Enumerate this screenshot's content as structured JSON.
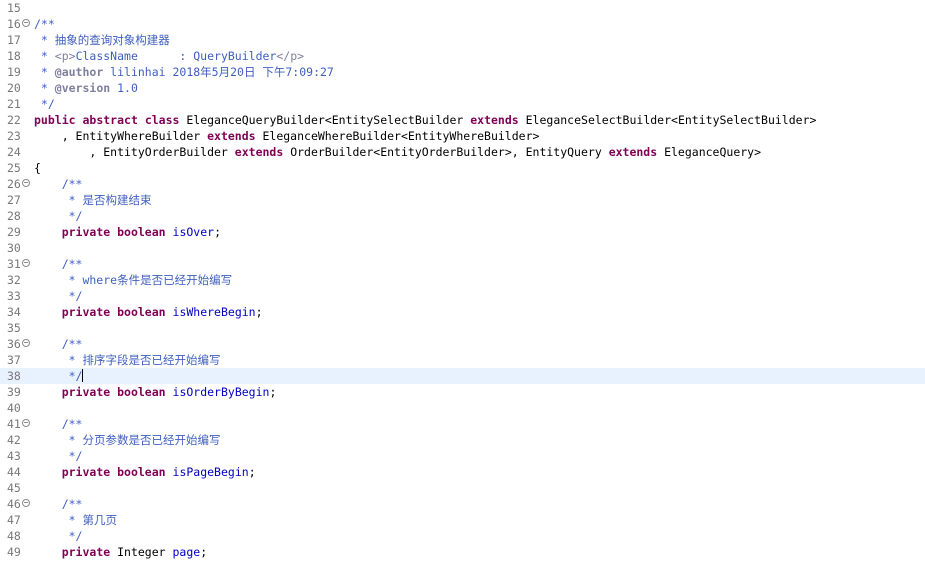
{
  "editor": {
    "colors": {
      "comment": "#3f5fbf",
      "javadoc_tag": "#7f7f9f",
      "keyword": "#7f0055",
      "field": "#0000c0",
      "line_number": "#787878",
      "current_line": "#e8f2fe"
    },
    "lines": [
      {
        "n": "15",
        "fold": false,
        "tokens": []
      },
      {
        "n": "16",
        "fold": true,
        "tokens": [
          {
            "t": "/**",
            "c": "comment"
          }
        ]
      },
      {
        "n": "17",
        "fold": false,
        "tokens": [
          {
            "t": " * 抽象的查询对象构建器",
            "c": "comment"
          }
        ]
      },
      {
        "n": "18",
        "fold": false,
        "tokens": [
          {
            "t": " * ",
            "c": "comment"
          },
          {
            "t": "<p>",
            "c": "tag"
          },
          {
            "t": "ClassName      : QueryBuilder",
            "c": "comment"
          },
          {
            "t": "</p>",
            "c": "tag"
          }
        ]
      },
      {
        "n": "19",
        "fold": false,
        "tokens": [
          {
            "t": " * ",
            "c": "comment"
          },
          {
            "t": "@author",
            "c": "tagbold"
          },
          {
            "t": " lilinhai 2018年5月20日 下午7:09:27",
            "c": "comment"
          }
        ]
      },
      {
        "n": "20",
        "fold": false,
        "tokens": [
          {
            "t": " * ",
            "c": "comment"
          },
          {
            "t": "@version",
            "c": "tagbold"
          },
          {
            "t": " 1.0",
            "c": "comment"
          }
        ]
      },
      {
        "n": "21",
        "fold": false,
        "tokens": [
          {
            "t": " */",
            "c": "comment"
          }
        ]
      },
      {
        "n": "22",
        "fold": false,
        "tokens": [
          {
            "t": "public",
            "c": "keyword"
          },
          {
            "t": " ",
            "c": "plain"
          },
          {
            "t": "abstract",
            "c": "keyword"
          },
          {
            "t": " ",
            "c": "plain"
          },
          {
            "t": "class",
            "c": "keyword"
          },
          {
            "t": " EleganceQueryBuilder<EntitySelectBuilder ",
            "c": "plain"
          },
          {
            "t": "extends",
            "c": "keyword"
          },
          {
            "t": " EleganceSelectBuilder<EntitySelectBuilder>",
            "c": "plain"
          }
        ]
      },
      {
        "n": "23",
        "fold": false,
        "tokens": [
          {
            "t": "    , EntityWhereBuilder ",
            "c": "plain"
          },
          {
            "t": "extends",
            "c": "keyword"
          },
          {
            "t": " EleganceWhereBuilder<EntityWhereBuilder>",
            "c": "plain"
          }
        ]
      },
      {
        "n": "24",
        "fold": false,
        "tokens": [
          {
            "t": "        , EntityOrderBuilder ",
            "c": "plain"
          },
          {
            "t": "extends",
            "c": "keyword"
          },
          {
            "t": " OrderBuilder<EntityOrderBuilder>, EntityQuery ",
            "c": "plain"
          },
          {
            "t": "extends",
            "c": "keyword"
          },
          {
            "t": " EleganceQuery>",
            "c": "plain"
          }
        ]
      },
      {
        "n": "25",
        "fold": false,
        "tokens": [
          {
            "t": "{",
            "c": "plain"
          }
        ]
      },
      {
        "n": "26",
        "fold": true,
        "tokens": [
          {
            "t": "    ",
            "c": "plain"
          },
          {
            "t": "/**",
            "c": "comment"
          }
        ]
      },
      {
        "n": "27",
        "fold": false,
        "tokens": [
          {
            "t": "     * 是否构建结束",
            "c": "comment"
          }
        ]
      },
      {
        "n": "28",
        "fold": false,
        "tokens": [
          {
            "t": "     */",
            "c": "comment"
          }
        ]
      },
      {
        "n": "29",
        "fold": false,
        "tokens": [
          {
            "t": "    ",
            "c": "plain"
          },
          {
            "t": "private",
            "c": "keyword"
          },
          {
            "t": " ",
            "c": "plain"
          },
          {
            "t": "boolean",
            "c": "keyword"
          },
          {
            "t": " ",
            "c": "plain"
          },
          {
            "t": "isOver",
            "c": "field"
          },
          {
            "t": ";",
            "c": "plain"
          }
        ]
      },
      {
        "n": "30",
        "fold": false,
        "tokens": []
      },
      {
        "n": "31",
        "fold": true,
        "tokens": [
          {
            "t": "    ",
            "c": "plain"
          },
          {
            "t": "/**",
            "c": "comment"
          }
        ]
      },
      {
        "n": "32",
        "fold": false,
        "tokens": [
          {
            "t": "     * where条件是否已经开始编写",
            "c": "comment"
          }
        ]
      },
      {
        "n": "33",
        "fold": false,
        "tokens": [
          {
            "t": "     */",
            "c": "comment"
          }
        ]
      },
      {
        "n": "34",
        "fold": false,
        "tokens": [
          {
            "t": "    ",
            "c": "plain"
          },
          {
            "t": "private",
            "c": "keyword"
          },
          {
            "t": " ",
            "c": "plain"
          },
          {
            "t": "boolean",
            "c": "keyword"
          },
          {
            "t": " ",
            "c": "plain"
          },
          {
            "t": "isWhereBegin",
            "c": "field"
          },
          {
            "t": ";",
            "c": "plain"
          }
        ]
      },
      {
        "n": "35",
        "fold": false,
        "tokens": []
      },
      {
        "n": "36",
        "fold": true,
        "tokens": [
          {
            "t": "    ",
            "c": "plain"
          },
          {
            "t": "/**",
            "c": "comment"
          }
        ]
      },
      {
        "n": "37",
        "fold": false,
        "tokens": [
          {
            "t": "     * 排序字段是否已经开始编写",
            "c": "comment"
          }
        ]
      },
      {
        "n": "38",
        "fold": false,
        "current": true,
        "tokens": [
          {
            "t": "     */",
            "c": "comment"
          }
        ]
      },
      {
        "n": "39",
        "fold": false,
        "tokens": [
          {
            "t": "    ",
            "c": "plain"
          },
          {
            "t": "private",
            "c": "keyword"
          },
          {
            "t": " ",
            "c": "plain"
          },
          {
            "t": "boolean",
            "c": "keyword"
          },
          {
            "t": " ",
            "c": "plain"
          },
          {
            "t": "isOrderByBegin",
            "c": "field"
          },
          {
            "t": ";",
            "c": "plain"
          }
        ]
      },
      {
        "n": "40",
        "fold": false,
        "tokens": []
      },
      {
        "n": "41",
        "fold": true,
        "tokens": [
          {
            "t": "    ",
            "c": "plain"
          },
          {
            "t": "/**",
            "c": "comment"
          }
        ]
      },
      {
        "n": "42",
        "fold": false,
        "tokens": [
          {
            "t": "     * 分页参数是否已经开始编写",
            "c": "comment"
          }
        ]
      },
      {
        "n": "43",
        "fold": false,
        "tokens": [
          {
            "t": "     */",
            "c": "comment"
          }
        ]
      },
      {
        "n": "44",
        "fold": false,
        "tokens": [
          {
            "t": "    ",
            "c": "plain"
          },
          {
            "t": "private",
            "c": "keyword"
          },
          {
            "t": " ",
            "c": "plain"
          },
          {
            "t": "boolean",
            "c": "keyword"
          },
          {
            "t": " ",
            "c": "plain"
          },
          {
            "t": "isPageBegin",
            "c": "field"
          },
          {
            "t": ";",
            "c": "plain"
          }
        ]
      },
      {
        "n": "45",
        "fold": false,
        "tokens": []
      },
      {
        "n": "46",
        "fold": true,
        "tokens": [
          {
            "t": "    ",
            "c": "plain"
          },
          {
            "t": "/**",
            "c": "comment"
          }
        ]
      },
      {
        "n": "47",
        "fold": false,
        "tokens": [
          {
            "t": "     * 第几页",
            "c": "comment"
          }
        ]
      },
      {
        "n": "48",
        "fold": false,
        "tokens": [
          {
            "t": "     */",
            "c": "comment"
          }
        ]
      },
      {
        "n": "49",
        "fold": false,
        "tokens": [
          {
            "t": "    ",
            "c": "plain"
          },
          {
            "t": "private",
            "c": "keyword"
          },
          {
            "t": " Integer ",
            "c": "plain"
          },
          {
            "t": "page",
            "c": "field"
          },
          {
            "t": ";",
            "c": "plain"
          }
        ]
      }
    ]
  }
}
